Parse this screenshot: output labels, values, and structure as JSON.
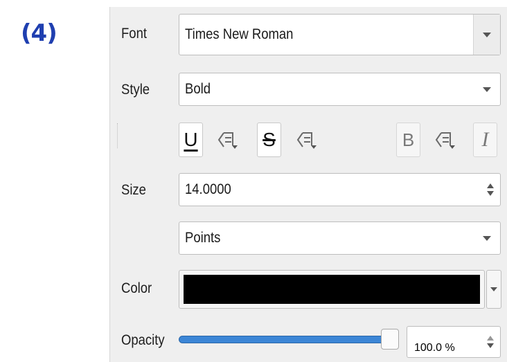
{
  "step_label": "(4)",
  "font": {
    "label": "Font",
    "value": "Times New Roman"
  },
  "style": {
    "label": "Style",
    "value": "Bold"
  },
  "toolbar": {
    "underline": "U",
    "strikeout": "S",
    "bold": "B",
    "italic": "I",
    "override_icon": "data-defined-override-icon"
  },
  "size": {
    "label": "Size",
    "value": "14.0000",
    "unit": "Points"
  },
  "color": {
    "label": "Color",
    "value": "#000000"
  },
  "opacity": {
    "label": "Opacity",
    "value": "100.0 %",
    "level": 1.0
  }
}
